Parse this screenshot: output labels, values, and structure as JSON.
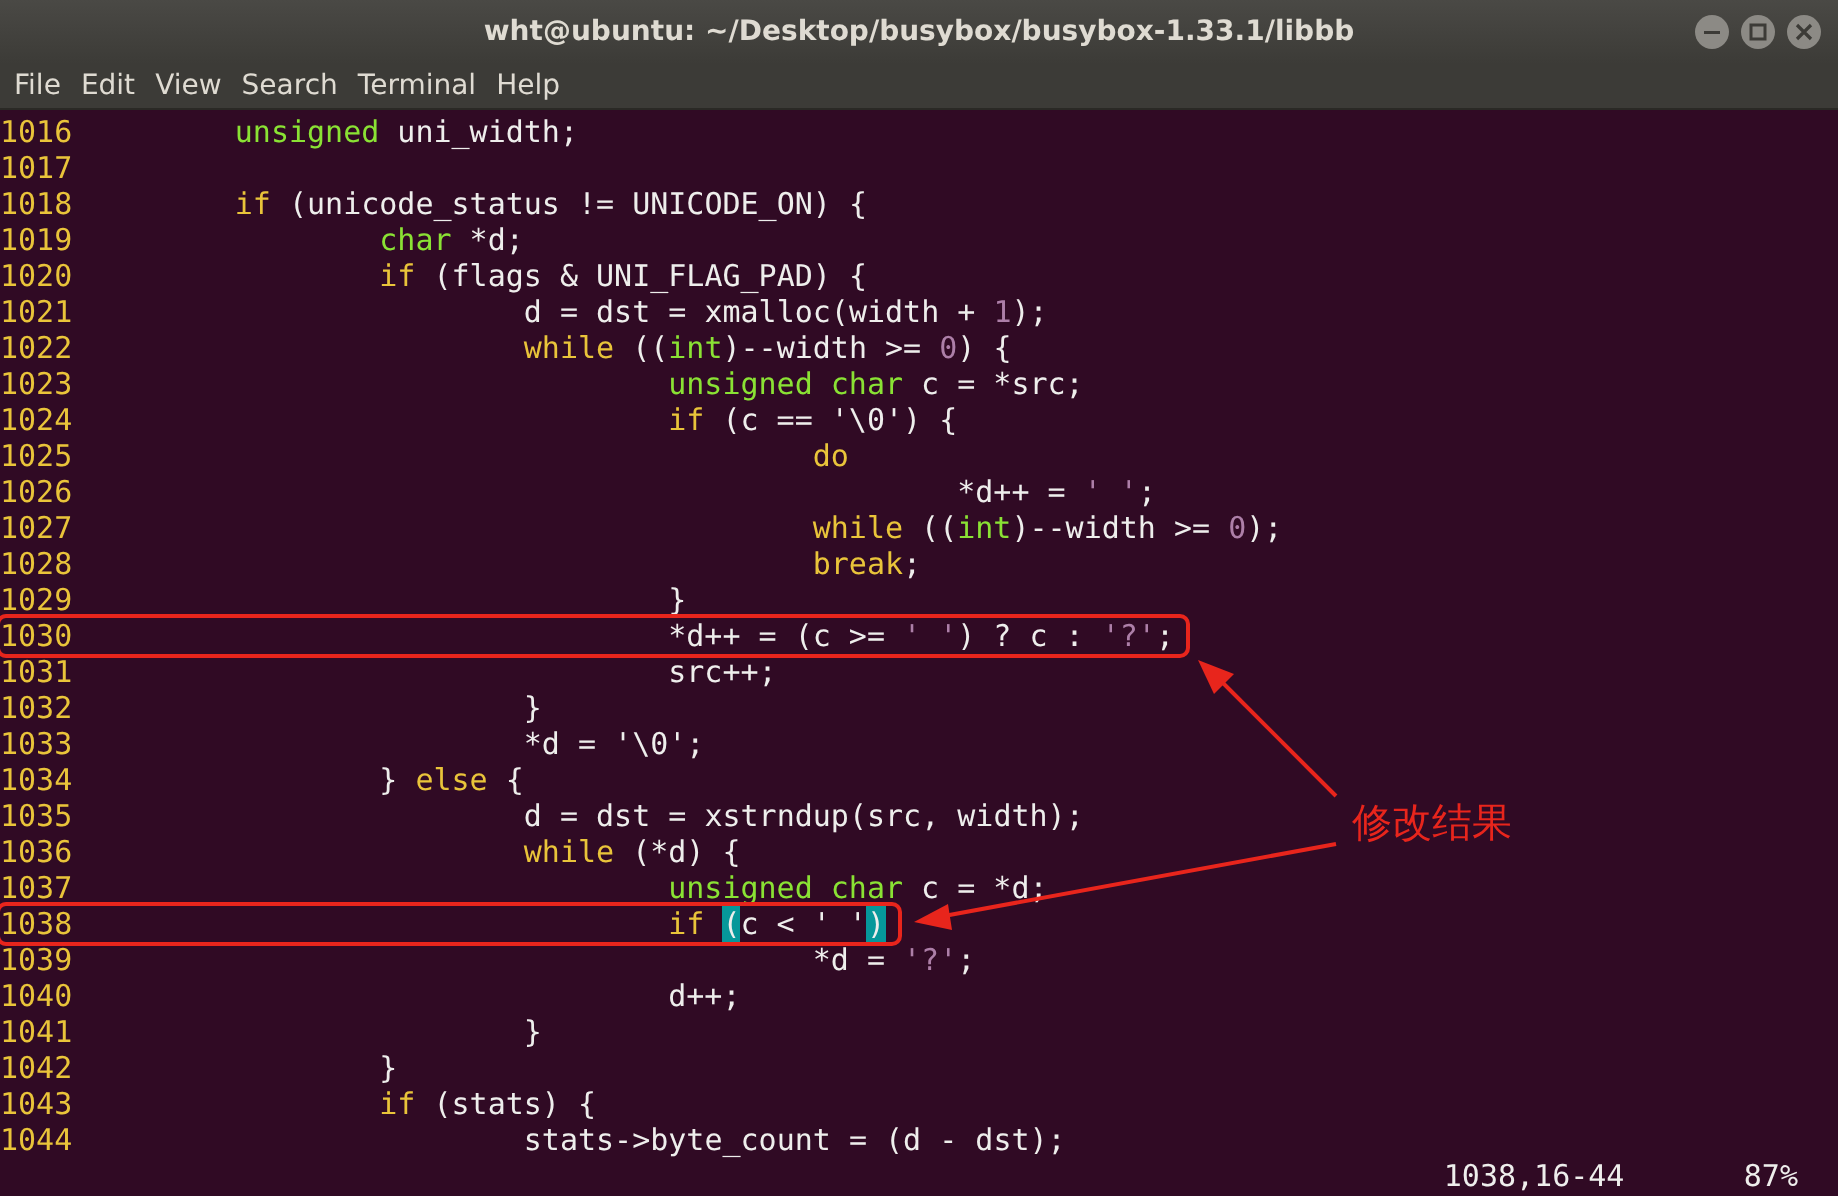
{
  "window": {
    "title": "wht@ubuntu: ~/Desktop/busybox/busybox-1.33.1/libbb"
  },
  "menu": [
    "File",
    "Edit",
    "View",
    "Search",
    "Terminal",
    "Help"
  ],
  "lines": [
    {
      "number": "1016",
      "boxed": false,
      "tokens": [
        {
          "kind": "type",
          "text": "\tunsigned"
        },
        {
          "kind": "plain",
          "text": " uni_width;"
        }
      ]
    },
    {
      "number": "1017",
      "boxed": false
    },
    {
      "number": "1018",
      "boxed": false,
      "tokens": [
        {
          "kind": "keyword",
          "text": "\tif"
        },
        {
          "kind": "plain",
          "text": " (unicode_status != UNICODE_ON) {"
        }
      ]
    },
    {
      "number": "1019",
      "boxed": false,
      "tokens": [
        {
          "kind": "type",
          "text": "\t\tchar"
        },
        {
          "kind": "plain",
          "text": " *d;"
        }
      ]
    },
    {
      "number": "1020",
      "boxed": false,
      "tokens": [
        {
          "kind": "keyword",
          "text": "\t\tif"
        },
        {
          "kind": "plain",
          "text": " (flags & UNI_FLAG_PAD) {"
        }
      ]
    },
    {
      "number": "1021",
      "boxed": false,
      "tokens": [
        {
          "kind": "plain",
          "text": "\t\t\td = dst = xmalloc(width + "
        },
        {
          "kind": "constant",
          "text": "1"
        },
        {
          "kind": "plain",
          "text": ");"
        }
      ]
    },
    {
      "number": "1022",
      "boxed": false,
      "tokens": [
        {
          "kind": "keyword",
          "text": "\t\t\twhile"
        },
        {
          "kind": "plain",
          "text": " (("
        },
        {
          "kind": "type",
          "text": "int"
        },
        {
          "kind": "plain",
          "text": ")--width >= "
        },
        {
          "kind": "constant",
          "text": "0"
        },
        {
          "kind": "plain",
          "text": ") {"
        }
      ]
    },
    {
      "number": "1023",
      "boxed": false,
      "tokens": [
        {
          "kind": "type",
          "text": "\t\t\t\tunsigned char"
        },
        {
          "kind": "plain",
          "text": " c = *src;"
        }
      ]
    },
    {
      "number": "1024",
      "boxed": false,
      "tokens": [
        {
          "kind": "keyword",
          "text": "\t\t\t\tif"
        },
        {
          "kind": "plain",
          "text": " (c == '\\0') {"
        }
      ]
    },
    {
      "number": "1025",
      "boxed": false,
      "tokens": [
        {
          "kind": "keyword",
          "text": "\t\t\t\t\tdo"
        }
      ]
    },
    {
      "number": "1026",
      "boxed": false,
      "tokens": [
        {
          "kind": "plain",
          "text": "\t\t\t\t\t\t*d++ = "
        },
        {
          "kind": "constant",
          "text": "' '"
        },
        {
          "kind": "plain",
          "text": ";"
        }
      ]
    },
    {
      "number": "1027",
      "boxed": false,
      "tokens": [
        {
          "kind": "keyword",
          "text": "\t\t\t\t\twhile"
        },
        {
          "kind": "plain",
          "text": " (("
        },
        {
          "kind": "type",
          "text": "int"
        },
        {
          "kind": "plain",
          "text": ")--width >= "
        },
        {
          "kind": "constant",
          "text": "0"
        },
        {
          "kind": "plain",
          "text": ");"
        }
      ]
    },
    {
      "number": "1028",
      "boxed": false,
      "tokens": [
        {
          "kind": "keyword",
          "text": "\t\t\t\t\tbreak"
        },
        {
          "kind": "plain",
          "text": ";"
        }
      ]
    },
    {
      "number": "1029",
      "boxed": false,
      "tokens": [
        {
          "kind": "plain",
          "text": "\t\t\t\t}"
        }
      ]
    },
    {
      "number": "1030",
      "boxed": true,
      "tokens": [
        {
          "kind": "plain",
          "text": "\t\t\t\t*d++ = (c >= "
        },
        {
          "kind": "constant",
          "text": "' '"
        },
        {
          "kind": "plain",
          "text": ") ? c : "
        },
        {
          "kind": "constant",
          "text": "'?'"
        },
        {
          "kind": "plain",
          "text": ";"
        }
      ]
    },
    {
      "number": "1031",
      "boxed": false,
      "tokens": [
        {
          "kind": "plain",
          "text": "\t\t\t\tsrc++;"
        }
      ]
    },
    {
      "number": "1032",
      "boxed": false,
      "tokens": [
        {
          "kind": "plain",
          "text": "\t\t\t}"
        }
      ]
    },
    {
      "number": "1033",
      "boxed": false,
      "tokens": [
        {
          "kind": "plain",
          "text": "\t\t\t*d = '\\0';"
        }
      ]
    },
    {
      "number": "1034",
      "boxed": false,
      "tokens": [
        {
          "kind": "plain",
          "text": "\t\t} "
        },
        {
          "kind": "keyword",
          "text": "else"
        },
        {
          "kind": "plain",
          "text": " {"
        }
      ]
    },
    {
      "number": "1035",
      "boxed": false,
      "tokens": [
        {
          "kind": "plain",
          "text": "\t\t\td = dst = xstrndup(src, width);"
        }
      ]
    },
    {
      "number": "1036",
      "boxed": false,
      "tokens": [
        {
          "kind": "keyword",
          "text": "\t\t\twhile"
        },
        {
          "kind": "plain",
          "text": " (*d) {"
        }
      ]
    },
    {
      "number": "1037",
      "boxed": false,
      "tokens": [
        {
          "kind": "type",
          "text": "\t\t\t\tunsigned char"
        },
        {
          "kind": "plain",
          "text": " c = *d;"
        }
      ]
    },
    {
      "number": "1038",
      "boxed": true,
      "tokens": [
        {
          "kind": "keyword",
          "text": "\t\t\t\tif "
        },
        {
          "kind": "match",
          "text": "("
        },
        {
          "kind": "plain",
          "text": "c < ' '"
        },
        {
          "kind": "match",
          "text": ")"
        }
      ]
    },
    {
      "number": "1039",
      "boxed": false,
      "tokens": [
        {
          "kind": "plain",
          "text": "\t\t\t\t\t*d = "
        },
        {
          "kind": "constant",
          "text": "'?'"
        },
        {
          "kind": "plain",
          "text": ";"
        }
      ]
    },
    {
      "number": "1040",
      "boxed": false,
      "tokens": [
        {
          "kind": "plain",
          "text": "\t\t\t\td++;"
        }
      ]
    },
    {
      "number": "1041",
      "boxed": false,
      "tokens": [
        {
          "kind": "plain",
          "text": "\t\t\t}"
        }
      ]
    },
    {
      "number": "1042",
      "boxed": false,
      "tokens": [
        {
          "kind": "plain",
          "text": "\t\t}"
        }
      ]
    },
    {
      "number": "1043",
      "boxed": false,
      "tokens": [
        {
          "kind": "keyword",
          "text": "\t\tif"
        },
        {
          "kind": "plain",
          "text": " (stats) {"
        }
      ]
    },
    {
      "number": "1044",
      "boxed": false,
      "tokens": [
        {
          "kind": "plain",
          "text": "\t\t\tstats->byte_count = (d - dst);"
        }
      ]
    }
  ],
  "status": {
    "position": "1038,16-44",
    "scroll": "87%"
  },
  "annotation": {
    "label": "修改结果"
  }
}
